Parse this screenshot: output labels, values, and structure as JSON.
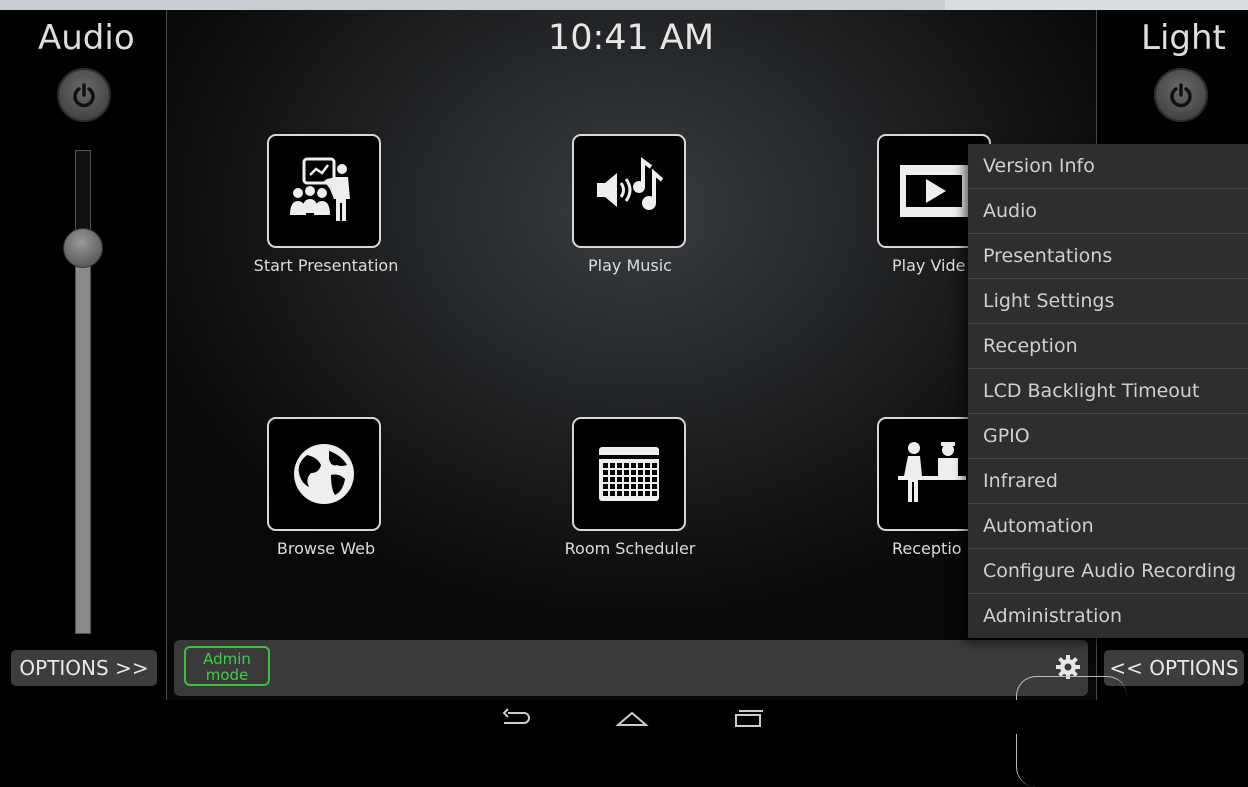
{
  "clock": "10:41 AM",
  "audio_panel": {
    "title": "Audio",
    "volume_level": 0.8,
    "options_label": "OPTIONS >>"
  },
  "light_panel": {
    "title": "Light",
    "options_label": "<< OPTIONS"
  },
  "tiles": [
    {
      "label": "Start Presentation",
      "icon": "presentation-icon"
    },
    {
      "label": "Play Music",
      "icon": "music-icon"
    },
    {
      "label": "Play Vide",
      "icon": "video-icon"
    },
    {
      "label": "Browse Web",
      "icon": "globe-icon"
    },
    {
      "label": "Room Scheduler",
      "icon": "calendar-icon"
    },
    {
      "label": "Receptio",
      "icon": "reception-icon"
    }
  ],
  "admin_mode": {
    "line1": "Admin",
    "line2": "mode"
  },
  "menu": {
    "items": [
      "Version Info",
      "Audio",
      "Presentations",
      "Light Settings",
      "Reception",
      "LCD Backlight Timeout",
      "GPIO",
      "Infrared",
      "Automation",
      "Configure Audio Recording",
      "Administration"
    ]
  },
  "colors": {
    "admin_green": "#35c33a",
    "menu_bg": "#2e2e2e",
    "bar_bg": "#3a3a3a"
  }
}
